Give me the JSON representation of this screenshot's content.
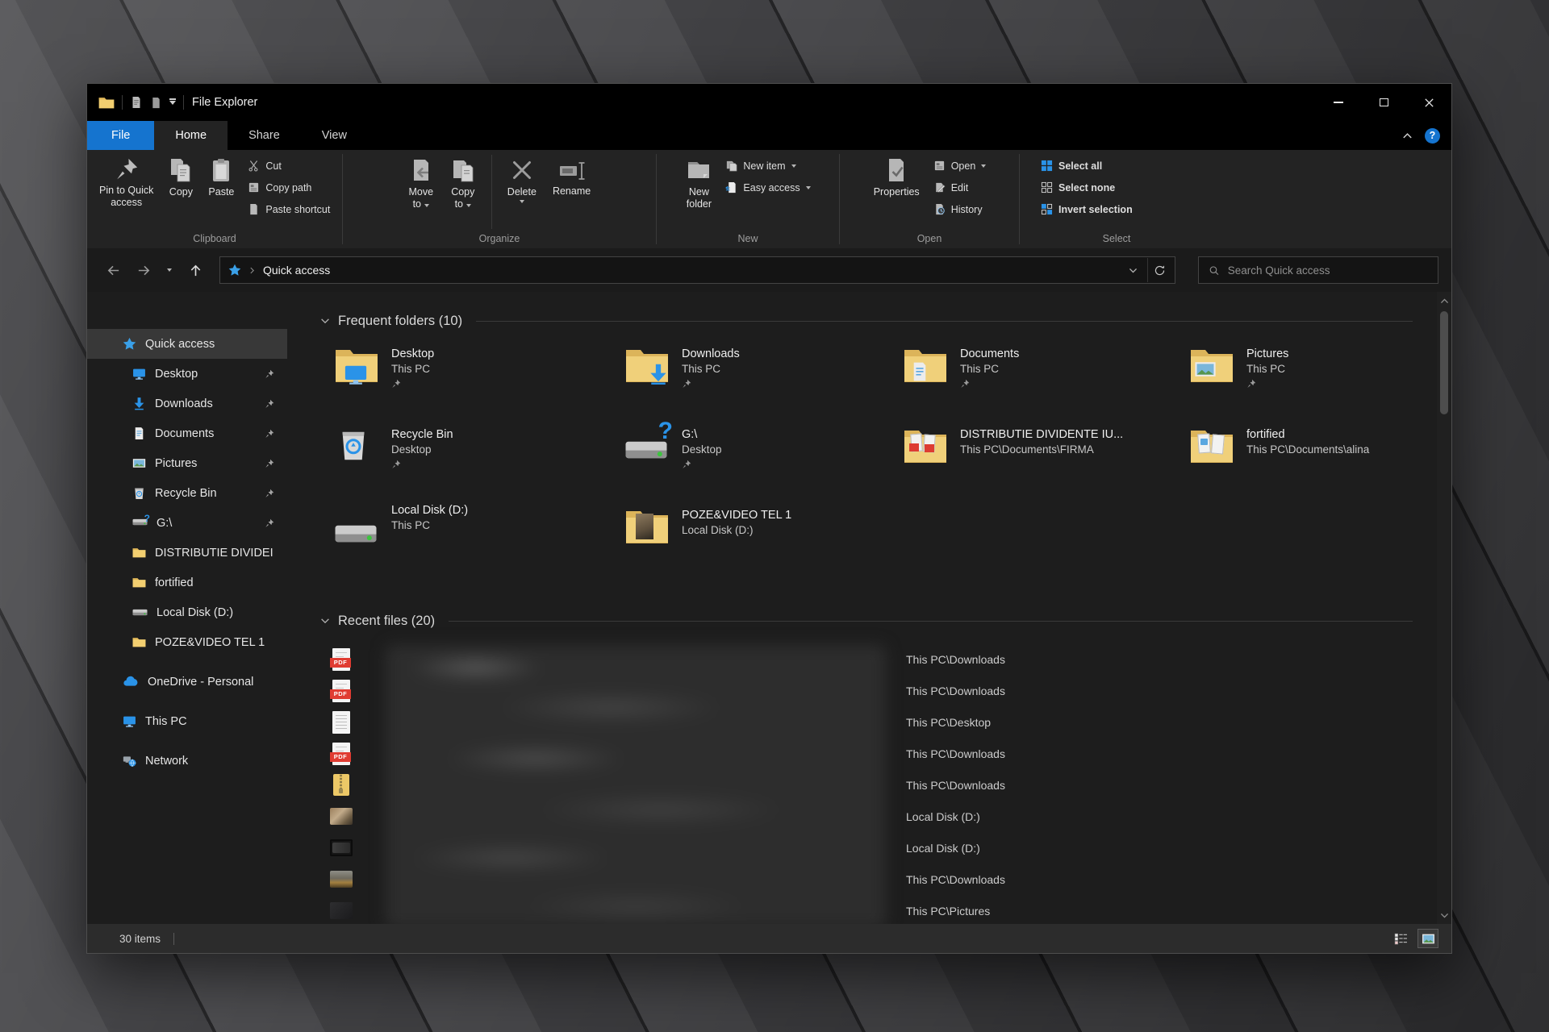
{
  "icons": {
    "question": "?"
  },
  "titlebar": {
    "title": "File Explorer"
  },
  "tabs": {
    "file": "File",
    "home": "Home",
    "share": "Share",
    "view": "View"
  },
  "ribbon": {
    "clipboard": {
      "label": "Clipboard",
      "pin_line1": "Pin to Quick",
      "pin_line2": "access",
      "copy": "Copy",
      "paste": "Paste",
      "cut": "Cut",
      "copy_path": "Copy path",
      "paste_shortcut": "Paste shortcut"
    },
    "organize": {
      "label": "Organize",
      "move_line1": "Move",
      "move_line2": "to",
      "copy_line1": "Copy",
      "copy_line2": "to",
      "delete": "Delete",
      "rename": "Rename"
    },
    "new_group": {
      "label": "New",
      "folder_line1": "New",
      "folder_line2": "folder",
      "new_item": "New item",
      "easy_access": "Easy access"
    },
    "open_group": {
      "label": "Open",
      "properties": "Properties",
      "open": "Open",
      "edit": "Edit",
      "history": "History"
    },
    "select_group": {
      "label": "Select",
      "select_all": "Select all",
      "select_none": "Select none",
      "invert": "Invert selection"
    }
  },
  "addressbar": {
    "location": "Quick access",
    "search_placeholder": "Search Quick access"
  },
  "sidebar": {
    "items": [
      {
        "label": "Quick access"
      },
      {
        "label": "Desktop"
      },
      {
        "label": "Downloads"
      },
      {
        "label": "Documents"
      },
      {
        "label": "Pictures"
      },
      {
        "label": "Recycle Bin"
      },
      {
        "label": "G:\\"
      },
      {
        "label": "DISTRIBUTIE DIVIDEI"
      },
      {
        "label": "fortified"
      },
      {
        "label": "Local Disk (D:)"
      },
      {
        "label": "POZE&VIDEO TEL 1"
      },
      {
        "label": "OneDrive - Personal"
      },
      {
        "label": "This PC"
      },
      {
        "label": "Network"
      }
    ]
  },
  "content": {
    "frequent_header": "Frequent folders (10)",
    "frequent": [
      {
        "name": "Desktop",
        "location": "This PC"
      },
      {
        "name": "Downloads",
        "location": "This PC"
      },
      {
        "name": "Documents",
        "location": "This PC"
      },
      {
        "name": "Pictures",
        "location": "This PC"
      },
      {
        "name": "Recycle Bin",
        "location": "Desktop"
      },
      {
        "name": "G:\\",
        "location": "Desktop"
      },
      {
        "name": "DISTRIBUTIE DIVIDENTE IU...",
        "location": "This PC\\Documents\\FIRMA"
      },
      {
        "name": "fortified",
        "location": "This PC\\Documents\\alina"
      },
      {
        "name": "Local Disk (D:)",
        "location": "This PC"
      },
      {
        "name": "POZE&VIDEO TEL 1",
        "location": "Local Disk (D:)"
      }
    ],
    "recent_header": "Recent files (20)",
    "pdf_badge": "PDF",
    "recent": [
      {
        "path": "This PC\\Downloads"
      },
      {
        "path": "This PC\\Downloads"
      },
      {
        "path": "This PC\\Desktop"
      },
      {
        "path": "This PC\\Downloads"
      },
      {
        "path": "This PC\\Downloads"
      },
      {
        "path": "Local Disk (D:)"
      },
      {
        "path": "Local Disk (D:)"
      },
      {
        "path": "This PC\\Downloads"
      },
      {
        "path": "This PC\\Pictures"
      }
    ]
  },
  "statusbar": {
    "items_count": "30 items"
  }
}
